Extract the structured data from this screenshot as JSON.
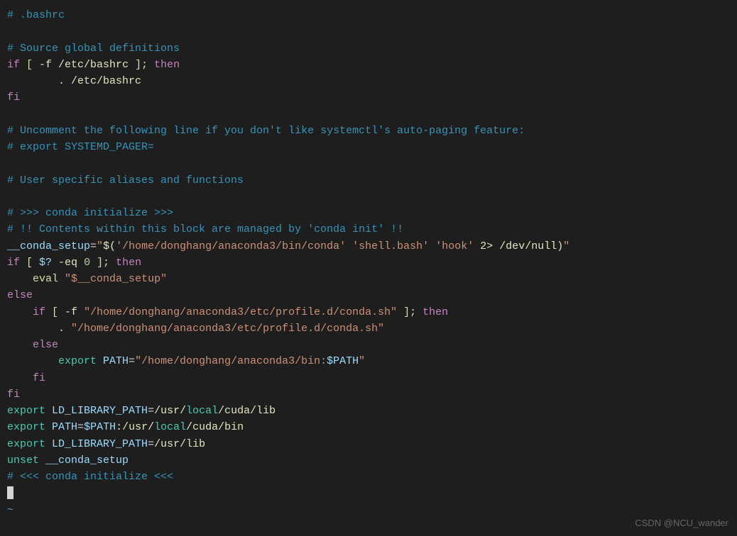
{
  "lines": {
    "l1_comment": "# .bashrc",
    "l3_comment": "# Source global definitions",
    "l4_if": "if",
    "l4_bracket_open": " [ ",
    "l4_flag": "-f",
    "l4_path": " /etc/bashrc ",
    "l4_bracket_close": "]; ",
    "l4_then": "then",
    "l5_dot": "        . ",
    "l5_path": "/etc/bashrc",
    "l6_fi": "fi",
    "l8_comment": "# Uncomment the following line if you don't like systemctl's auto-paging feature:",
    "l9_comment": "# export SYSTEMD_PAGER=",
    "l11_comment": "# User specific aliases and functions",
    "l13_comment": "# >>> conda initialize >>>",
    "l14_comment": "# !! Contents within this block are managed by 'conda init' !!",
    "l15_var": "__conda_setup",
    "l15_eq": "=",
    "l15_q1": "\"",
    "l15_dollar": "$(",
    "l15_str1": "'/home/donghang/anaconda3/bin/conda'",
    "l15_sp1": " ",
    "l15_str2": "'shell.bash'",
    "l15_sp2": " ",
    "l15_str3": "'hook'",
    "l15_redir": " 2> ",
    "l15_devnull": "/dev/null",
    "l15_close": ")",
    "l15_q2": "\"",
    "l16_if": "if",
    "l16_br1": " [ ",
    "l16_var": "$?",
    "l16_eq": " -eq ",
    "l16_num": "0",
    "l16_br2": " ]; ",
    "l16_then": "then",
    "l17_indent": "    ",
    "l17_eval": "eval",
    "l17_sp": " ",
    "l17_str": "\"$__conda_setup\"",
    "l18_else": "else",
    "l19_indent": "    ",
    "l19_if": "if",
    "l19_br1": " [ ",
    "l19_flag": "-f",
    "l19_sp": " ",
    "l19_str": "\"/home/donghang/anaconda3/etc/profile.d/conda.sh\"",
    "l19_br2": " ]; ",
    "l19_then": "then",
    "l20_indent": "        ",
    "l20_dot": ".",
    "l20_sp": " ",
    "l20_str": "\"/home/donghang/anaconda3/etc/profile.d/conda.sh\"",
    "l21_indent": "    ",
    "l21_else": "else",
    "l22_indent": "        ",
    "l22_export": "export",
    "l22_sp": " ",
    "l22_var": "PATH",
    "l22_eq": "=",
    "l22_q1": "\"/home/donghang/anaconda3/bin:",
    "l22_pathvar": "$PATH",
    "l22_q2": "\"",
    "l23_indent": "    ",
    "l23_fi": "fi",
    "l24_fi": "fi",
    "l25_export": "export",
    "l25_sp": " ",
    "l25_var": "LD_LIBRARY_PATH",
    "l25_eq": "=",
    "l25_p1": "/usr/",
    "l25_local": "local",
    "l25_p2": "/cuda/lib",
    "l26_export": "export",
    "l26_sp": " ",
    "l26_var": "PATH",
    "l26_eq": "=",
    "l26_pathvar": "$PATH",
    "l26_p1": ":/usr/",
    "l26_local": "local",
    "l26_p2": "/cuda/bin",
    "l27_export": "export",
    "l27_sp": " ",
    "l27_var": "LD_LIBRARY_PATH",
    "l27_eq": "=",
    "l27_path": "/usr/lib",
    "l28_unset": "unset",
    "l28_sp": " ",
    "l28_var": "__conda_setup",
    "l29_comment": "# <<< conda initialize <<<",
    "tilde": "~"
  },
  "watermark": "CSDN @NCU_wander"
}
